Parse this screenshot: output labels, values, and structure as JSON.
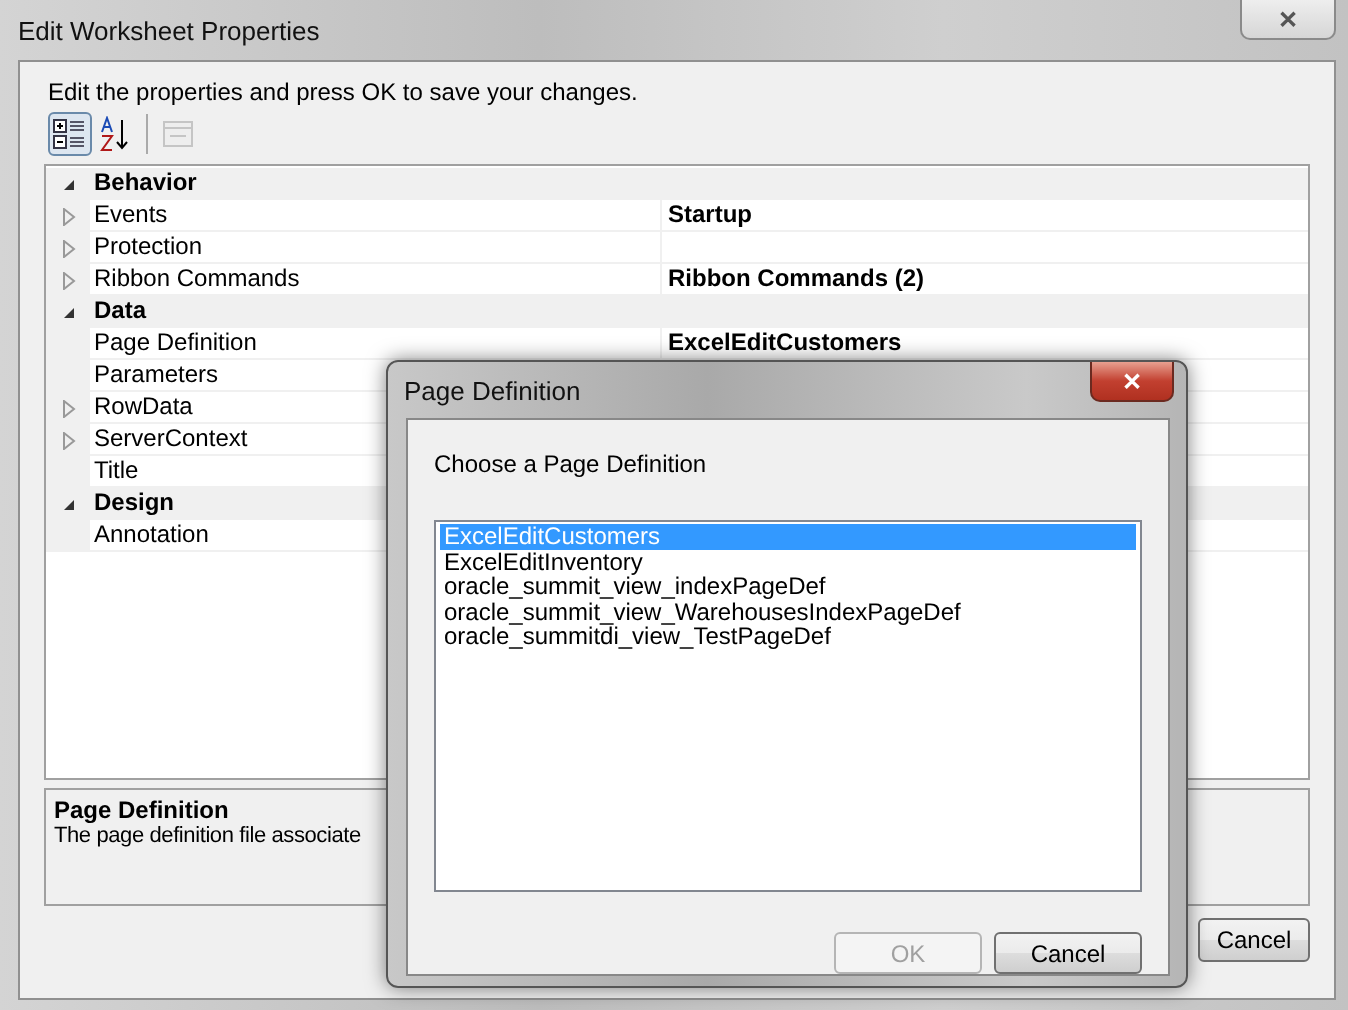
{
  "window": {
    "title": "Edit Worksheet Properties",
    "close": "✕"
  },
  "instruction": "Edit the properties and press OK to save your changes.",
  "toolbar": [
    {
      "kind": "categorized",
      "selected": true,
      "disabled": false
    },
    {
      "kind": "alphabetical",
      "selected": false,
      "disabled": false
    },
    {
      "kind": "pages",
      "selected": false,
      "disabled": true
    }
  ],
  "categories": [
    {
      "name": "Behavior",
      "expanded": true,
      "items": [
        {
          "name": "Events",
          "value": "Startup",
          "expandable": true
        },
        {
          "name": "Protection",
          "expandable": true
        },
        {
          "name": "Ribbon Commands",
          "value": "Ribbon Commands (2)",
          "expandable": true
        }
      ]
    },
    {
      "name": "Data",
      "expanded": true,
      "items": [
        {
          "name": "Page Definition",
          "value": "ExcelEditCustomers",
          "expandable": false
        },
        {
          "name": "Parameters",
          "expandable": false
        },
        {
          "name": "RowData",
          "expandable": true
        },
        {
          "name": "ServerContext",
          "expandable": true
        },
        {
          "name": "Title",
          "expandable": false
        }
      ]
    },
    {
      "name": "Design",
      "expanded": true,
      "items": [
        {
          "name": "Annotation",
          "expandable": false
        }
      ]
    }
  ],
  "description": {
    "title": "Page Definition",
    "text": "The page definition file associate"
  },
  "buttons": [
    {
      "label": "Cancel",
      "disabled": false
    }
  ],
  "dialog": {
    "title": "Page Definition",
    "close": "✕",
    "prompt": "Choose a Page Definition",
    "options": [
      {
        "label": "ExcelEditCustomers",
        "selected": true
      },
      {
        "label": "ExcelEditInventory",
        "selected": false
      },
      {
        "label": "oracle_summit_view_indexPageDef",
        "selected": false
      },
      {
        "label": "oracle_summit_view_WarehousesIndexPageDef",
        "selected": false
      },
      {
        "label": "oracle_summitdi_view_TestPageDef",
        "selected": false
      }
    ],
    "buttons": [
      {
        "label": "OK",
        "disabled": true
      },
      {
        "label": "Cancel",
        "disabled": false
      }
    ]
  }
}
